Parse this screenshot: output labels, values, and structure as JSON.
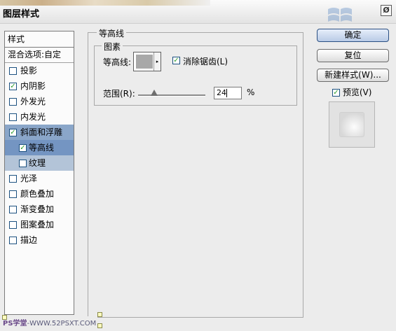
{
  "window": {
    "title": "图层样式",
    "close_glyph": "Ø"
  },
  "sidebar": {
    "header": "样式",
    "blend_options": "混合选项:自定",
    "items": [
      {
        "label": "投影",
        "checked": false
      },
      {
        "label": "内阴影",
        "checked": true
      },
      {
        "label": "外发光",
        "checked": false
      },
      {
        "label": "内发光",
        "checked": false
      },
      {
        "label": "斜面和浮雕",
        "checked": true
      },
      {
        "label": "等高线",
        "checked": true
      },
      {
        "label": "纹理",
        "checked": false
      },
      {
        "label": "光泽",
        "checked": false
      },
      {
        "label": "颜色叠加",
        "checked": false
      },
      {
        "label": "渐变叠加",
        "checked": false
      },
      {
        "label": "图案叠加",
        "checked": false
      },
      {
        "label": "描边",
        "checked": false
      }
    ]
  },
  "panel": {
    "group_title": "等高线",
    "subgroup_title": "图素",
    "contour_label": "等高线:",
    "antialias_label": "消除锯齿(L)",
    "antialias_checked": true,
    "range_label": "范围(R):",
    "range_value": "24",
    "range_unit": "%",
    "range_fraction": 0.24
  },
  "buttons": {
    "ok": "确定",
    "reset": "复位",
    "new_style": "新建样式(W)...",
    "preview_label": "预览(V)",
    "preview_checked": true
  },
  "watermark": {
    "brand": "PS学堂",
    "site": "-WWW.52PSXT.COM"
  },
  "colors": {
    "selected_row": "#8aa6c9",
    "sub_row": "#b3c4d8",
    "check": "#2b9b2b",
    "primary_button": "#b9cbe6"
  },
  "icons": {
    "check": "✓",
    "dropdown": "▸"
  }
}
